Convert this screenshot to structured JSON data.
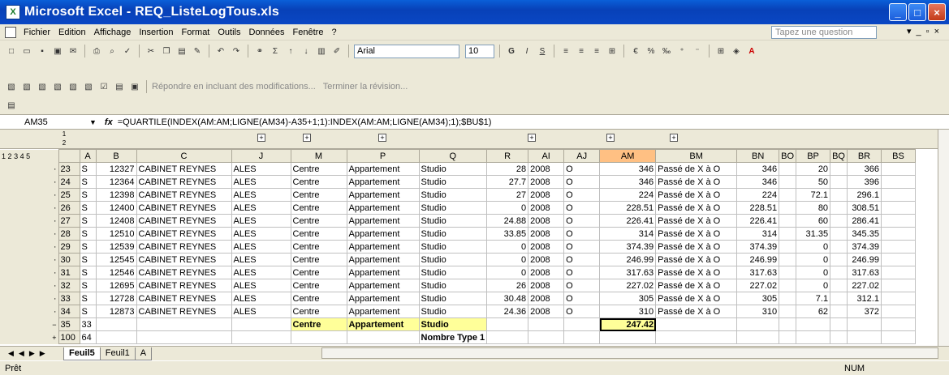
{
  "window": {
    "title": "Microsoft Excel - REQ_ListeLogTous.xls"
  },
  "menu": [
    "Fichier",
    "Edition",
    "Affichage",
    "Insertion",
    "Format",
    "Outils",
    "Données",
    "Fenêtre",
    "?"
  ],
  "ask_placeholder": "Tapez une question",
  "font": {
    "name": "Arial",
    "size": "10"
  },
  "review_bar": {
    "reply_text": "Répondre en incluant des modifications...",
    "end_review": "Terminer la révision..."
  },
  "name_box": "AM35",
  "formula": "=QUARTILE(INDEX(AM:AM;LIGNE(AM34)-A35+1;1):INDEX(AM:AM;LIGNE(AM34);1);$BU$1)",
  "outline_levels": [
    "1",
    "2",
    "3",
    "4",
    "5"
  ],
  "outline_col_levels": [
    "1",
    "2"
  ],
  "columns": [
    "A",
    "B",
    "C",
    "J",
    "M",
    "P",
    "Q",
    "R",
    "AI",
    "AJ",
    "AM",
    "BM",
    "BN",
    "BO",
    "BP",
    "BQ",
    "BR",
    "BS"
  ],
  "rows": [
    {
      "n": "23",
      "a": "S",
      "b": "12327",
      "c": "CABINET REYNES",
      "j": "ALES",
      "m": "Centre",
      "p": "Appartement",
      "q": "Studio",
      "r": "28",
      "ai": "2008",
      "aj": "O",
      "am": "346",
      "bm": "Passé de X à O",
      "bn": "346",
      "bp": "20",
      "br": "366"
    },
    {
      "n": "24",
      "a": "S",
      "b": "12364",
      "c": "CABINET REYNES",
      "j": "ALES",
      "m": "Centre",
      "p": "Appartement",
      "q": "Studio",
      "r": "27.7",
      "ai": "2008",
      "aj": "O",
      "am": "346",
      "bm": "Passé de X à O",
      "bn": "346",
      "bp": "50",
      "br": "396"
    },
    {
      "n": "25",
      "a": "S",
      "b": "12398",
      "c": "CABINET REYNES",
      "j": "ALES",
      "m": "Centre",
      "p": "Appartement",
      "q": "Studio",
      "r": "27",
      "ai": "2008",
      "aj": "O",
      "am": "224",
      "bm": "Passé de X à O",
      "bn": "224",
      "bp": "72.1",
      "br": "296.1"
    },
    {
      "n": "26",
      "a": "S",
      "b": "12400",
      "c": "CABINET REYNES",
      "j": "ALES",
      "m": "Centre",
      "p": "Appartement",
      "q": "Studio",
      "r": "0",
      "ai": "2008",
      "aj": "O",
      "am": "228.51",
      "bm": "Passé de X à O",
      "bn": "228.51",
      "bp": "80",
      "br": "308.51"
    },
    {
      "n": "27",
      "a": "S",
      "b": "12408",
      "c": "CABINET REYNES",
      "j": "ALES",
      "m": "Centre",
      "p": "Appartement",
      "q": "Studio",
      "r": "24.88",
      "ai": "2008",
      "aj": "O",
      "am": "226.41",
      "bm": "Passé de X à O",
      "bn": "226.41",
      "bp": "60",
      "br": "286.41"
    },
    {
      "n": "28",
      "a": "S",
      "b": "12510",
      "c": "CABINET REYNES",
      "j": "ALES",
      "m": "Centre",
      "p": "Appartement",
      "q": "Studio",
      "r": "33.85",
      "ai": "2008",
      "aj": "O",
      "am": "314",
      "bm": "Passé de X à O",
      "bn": "314",
      "bp": "31.35",
      "br": "345.35"
    },
    {
      "n": "29",
      "a": "S",
      "b": "12539",
      "c": "CABINET REYNES",
      "j": "ALES",
      "m": "Centre",
      "p": "Appartement",
      "q": "Studio",
      "r": "0",
      "ai": "2008",
      "aj": "O",
      "am": "374.39",
      "bm": "Passé de X à O",
      "bn": "374.39",
      "bp": "0",
      "br": "374.39"
    },
    {
      "n": "30",
      "a": "S",
      "b": "12545",
      "c": "CABINET REYNES",
      "j": "ALES",
      "m": "Centre",
      "p": "Appartement",
      "q": "Studio",
      "r": "0",
      "ai": "2008",
      "aj": "O",
      "am": "246.99",
      "bm": "Passé de X à O",
      "bn": "246.99",
      "bp": "0",
      "br": "246.99"
    },
    {
      "n": "31",
      "a": "S",
      "b": "12546",
      "c": "CABINET REYNES",
      "j": "ALES",
      "m": "Centre",
      "p": "Appartement",
      "q": "Studio",
      "r": "0",
      "ai": "2008",
      "aj": "O",
      "am": "317.63",
      "bm": "Passé de X à O",
      "bn": "317.63",
      "bp": "0",
      "br": "317.63"
    },
    {
      "n": "32",
      "a": "S",
      "b": "12695",
      "c": "CABINET REYNES",
      "j": "ALES",
      "m": "Centre",
      "p": "Appartement",
      "q": "Studio",
      "r": "26",
      "ai": "2008",
      "aj": "O",
      "am": "227.02",
      "bm": "Passé de X à O",
      "bn": "227.02",
      "bp": "0",
      "br": "227.02"
    },
    {
      "n": "33",
      "a": "S",
      "b": "12728",
      "c": "CABINET REYNES",
      "j": "ALES",
      "m": "Centre",
      "p": "Appartement",
      "q": "Studio",
      "r": "30.48",
      "ai": "2008",
      "aj": "O",
      "am": "305",
      "bm": "Passé de X à O",
      "bn": "305",
      "bp": "7.1",
      "br": "312.1"
    },
    {
      "n": "34",
      "a": "S",
      "b": "12873",
      "c": "CABINET REYNES",
      "j": "ALES",
      "m": "Centre",
      "p": "Appartement",
      "q": "Studio",
      "r": "24.36",
      "ai": "2008",
      "aj": "O",
      "am": "310",
      "bm": "Passé de X à O",
      "bn": "310",
      "bp": "62",
      "br": "372"
    }
  ],
  "summary_row": {
    "n": "35",
    "a": "33",
    "m": "Centre",
    "p": "Appartement",
    "q": "Studio",
    "am": "247.42"
  },
  "total_row": {
    "n": "100",
    "a": "64",
    "q": "Nombre Type 1"
  },
  "sheets": [
    "Feuil5",
    "Feuil1",
    "A"
  ],
  "status": {
    "ready": "Prêt",
    "num": "NUM"
  }
}
